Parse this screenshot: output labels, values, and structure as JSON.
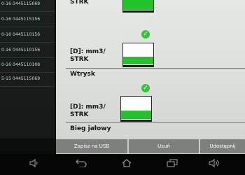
{
  "left_list": {
    "rows": [
      {
        "text": "0-16   0445115069"
      },
      {
        "text": "0-16   0445115156"
      },
      {
        "text": "0-16   0445110156"
      },
      {
        "text": "0-16   0445110156"
      },
      {
        "text": "0-16   0445110108"
      },
      {
        "text": "5-15   0445115069"
      }
    ]
  },
  "main": {
    "top_label": "STRK",
    "sections": [
      {
        "label_line1": "[D]: mm3/",
        "label_line2": "STRK",
        "title": "Wtrysk",
        "fill_percent": 45
      },
      {
        "label_line1": "[D]: mm3/",
        "label_line2": "STRK",
        "title": "Bieg jałowy",
        "fill_percent": 42
      }
    ],
    "top_gauge_fill_percent": 100
  },
  "actions": {
    "save_usb": "Zapisz na USB",
    "delete": "Usuń",
    "share": "Udostępnij"
  },
  "colors": {
    "accent_green": "#22c22b",
    "check_green": "#32c63a"
  },
  "nav_icons": [
    "volume-down-icon",
    "back-icon",
    "home-icon",
    "recent-apps-icon",
    "volume-up-icon"
  ]
}
